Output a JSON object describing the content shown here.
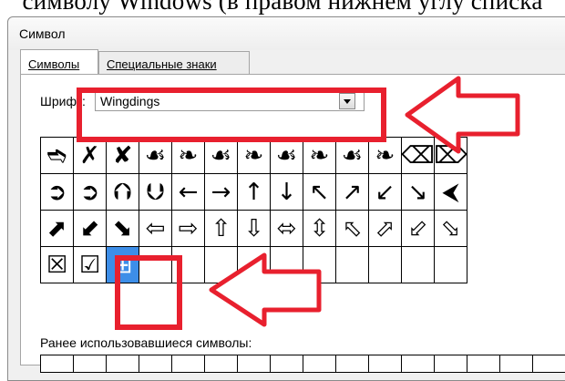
{
  "doc_fragment": "символу Windows (в правом нижнем углу списка",
  "dialog": {
    "title": "Символ",
    "tabs": [
      {
        "label": "Символы",
        "active": true
      },
      {
        "label": "Специальные знаки",
        "active": false
      }
    ],
    "font_label": "Шрифт:",
    "font_value": "Wingdings",
    "recent_label": "Ранее использовавшиеся символы:"
  },
  "symbol_grid": {
    "rows": [
      [
        "➬",
        "✗",
        "✘",
        "☙",
        "❧",
        "☙",
        "❧",
        "☙",
        "❧",
        "☙",
        "❧",
        "⌫",
        "⌦"
      ],
      [
        "➲",
        "➲",
        "⮉",
        "⮋",
        "←",
        "→",
        "↑",
        "↓",
        "↖",
        "↗",
        "↙",
        "↘",
        "⮜"
      ],
      [
        "⬈",
        "⬋",
        "⬊",
        "⇦",
        "⇨",
        "⇧",
        "⇩",
        "⬄",
        "⇳",
        "⬁",
        "⬀",
        "⬃",
        "⬂"
      ],
      [
        "☒",
        "☑",
        "⊞"
      ]
    ],
    "selected": [
      3,
      2
    ]
  },
  "annotation_color": "#e8202e"
}
